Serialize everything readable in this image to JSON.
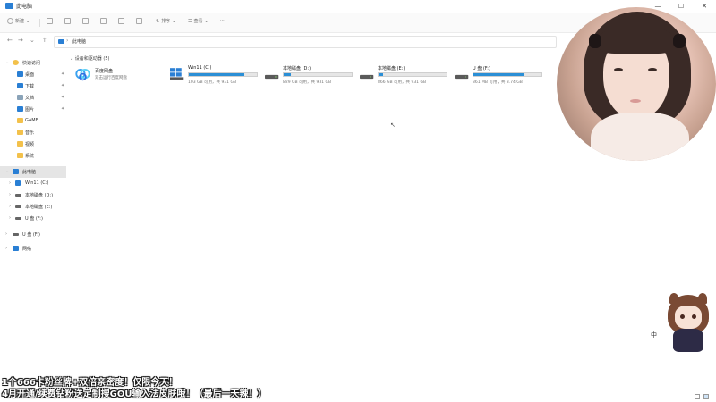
{
  "window": {
    "title": "此电脑",
    "minimize": "—",
    "maximize": "☐",
    "close": "✕"
  },
  "toolbar": {
    "new_label": "新建",
    "sort_label": "排序",
    "view_label": "查看",
    "more_label": "···"
  },
  "address": {
    "back": "←",
    "forward": "→",
    "recent": "⌄",
    "up": "↑",
    "separator": "›",
    "path_label": "此电脑"
  },
  "sidebar": {
    "quick_access": "快速访问",
    "items": [
      {
        "label": "桌面",
        "color": "#2a7fd4",
        "pinned": true
      },
      {
        "label": "下载",
        "color": "#2a7fd4",
        "pinned": true
      },
      {
        "label": "文档",
        "color": "#8aa3b8",
        "pinned": true
      },
      {
        "label": "图片",
        "color": "#2a7fd4",
        "pinned": true
      },
      {
        "label": "GAME",
        "color": "#f3c14b",
        "pinned": false
      },
      {
        "label": "音乐",
        "color": "#f3c14b",
        "pinned": false
      },
      {
        "label": "视频",
        "color": "#f3c14b",
        "pinned": false
      },
      {
        "label": "系统",
        "color": "#f3c14b",
        "pinned": false
      }
    ],
    "pin_glyph": "✦",
    "this_pc": "此电脑",
    "drives": [
      {
        "label": "Win11 (C:)"
      },
      {
        "label": "本地磁盘 (D:)"
      },
      {
        "label": "本地磁盘 (E:)"
      },
      {
        "label": "U 盘 (F:)"
      }
    ],
    "removable": "U 盘 (F:)",
    "network": "网络"
  },
  "main": {
    "group_header": "设备和驱动器 (5)",
    "app": {
      "name": "百度网盘",
      "subtitle": "双击运行百度网盘"
    },
    "drives": [
      {
        "name": "Win11 (C:)",
        "detail": "103 GB 可用，共 931 GB",
        "usage": 0.82
      },
      {
        "name": "本地磁盘 (D:)",
        "detail": "829 GB 可用，共 931 GB",
        "usage": 0.11
      },
      {
        "name": "本地磁盘 (E:)",
        "detail": "866 GB 可用，共 931 GB",
        "usage": 0.07
      },
      {
        "name": "U 盘 (F:)",
        "detail": "361 MB 可用，共 3.74 GB",
        "usage": 0.74
      }
    ]
  },
  "colors": {
    "accent": "#2b8fd6",
    "folder": "#f3c14b"
  },
  "mascot": {
    "label": "中"
  },
  "overlay": {
    "line1": "1个666卡粉丝牌+双倍亲密度！仅限今天！",
    "line2": "4月开通/续费钻粉送定制搜GOU输入法皮肤哦！（最后一天辣！）"
  }
}
